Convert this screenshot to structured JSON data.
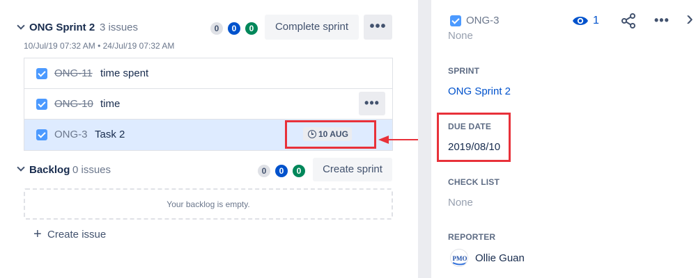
{
  "sprint": {
    "title": "ONG Sprint 2",
    "issue_count": "3 issues",
    "dates": "10/Jul/19 07:32 AM • 24/Jul/19 07:32 AM",
    "counts": [
      "0",
      "0",
      "0"
    ],
    "complete_label": "Complete sprint",
    "more_label": "•••"
  },
  "issues": [
    {
      "key": "ONG-11",
      "summary": "time spent",
      "done": true
    },
    {
      "key": "ONG-10",
      "summary": "time",
      "done": true
    },
    {
      "key": "ONG-3",
      "summary": "Task 2",
      "done": false
    }
  ],
  "row_more_label": "•••",
  "due_badge": "10 AUG",
  "backlog": {
    "title": "Backlog",
    "issue_count": "0 issues",
    "counts": [
      "0",
      "0",
      "0"
    ],
    "create_sprint_label": "Create sprint",
    "empty_text": "Your backlog is empty.",
    "create_issue_label": "Create issue",
    "create_issue_icon": "+"
  },
  "detail": {
    "issue_key": "ONG-3",
    "watchers": "1",
    "more_label": "•••",
    "close_glyph": "›",
    "top_value": "None",
    "fields": {
      "sprint_label": "SPRINT",
      "sprint_value": "ONG Sprint 2",
      "due_label": "DUE DATE",
      "due_value": "2019/08/10",
      "checklist_label": "CHECK LIST",
      "checklist_value": "None",
      "reporter_label": "REPORTER",
      "reporter_value": "Ollie Guan",
      "reporter_avatar_text": "PMO"
    }
  },
  "colors": {
    "accent": "#0052cc",
    "highlight": "#e8313a",
    "done_green": "#00875a",
    "selected_row": "#deebff"
  }
}
